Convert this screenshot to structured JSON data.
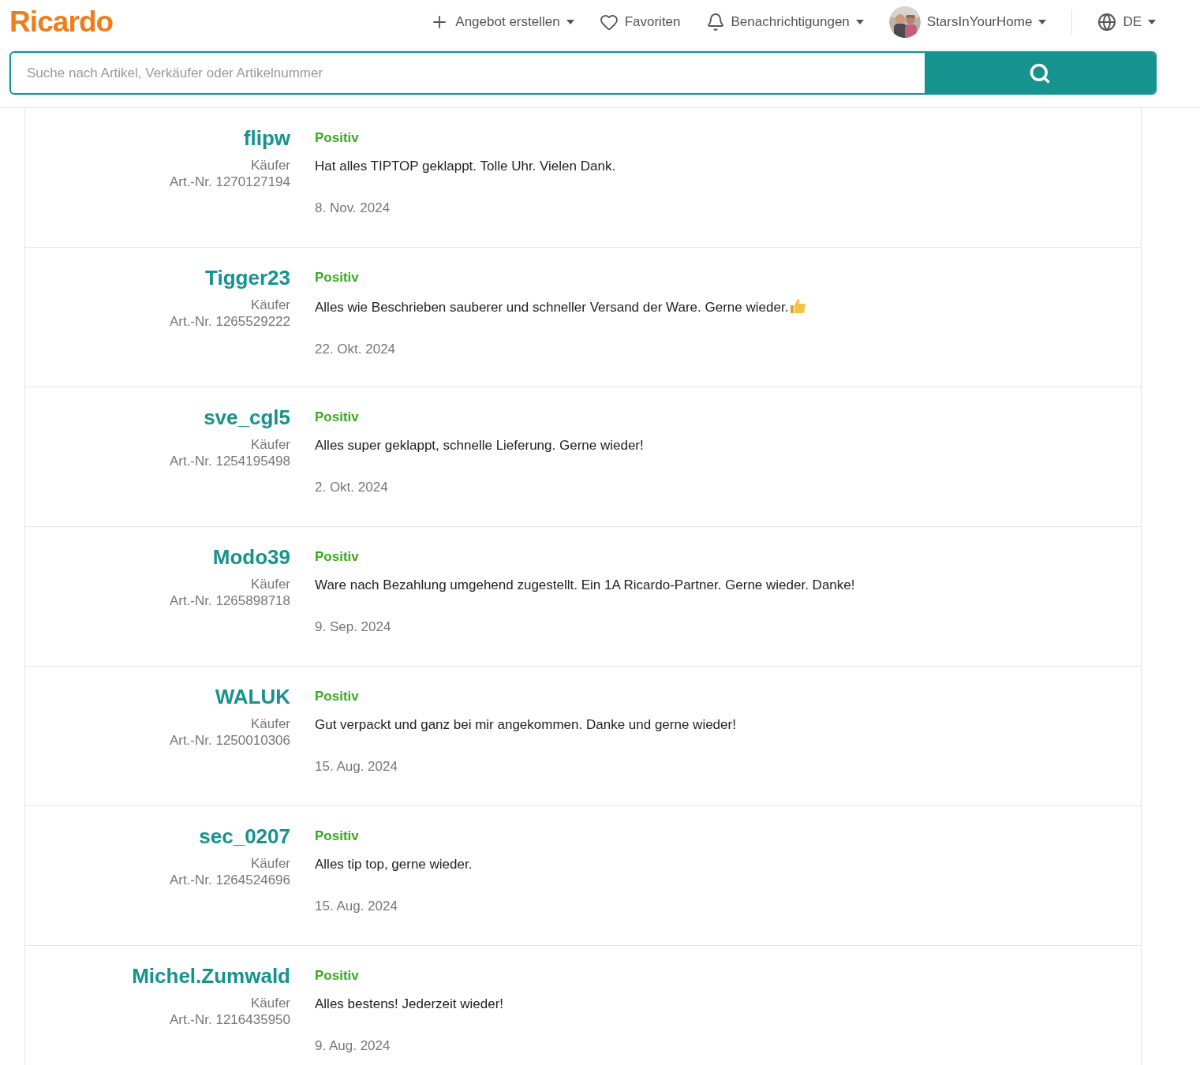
{
  "header": {
    "logo": "Ricardo",
    "nav": [
      {
        "kind": "create",
        "label": "Angebot erstellen",
        "dropdown": true
      },
      {
        "kind": "favorites",
        "label": "Favoriten",
        "dropdown": false
      },
      {
        "kind": "notifications",
        "label": "Benachrichtigungen",
        "dropdown": true
      },
      {
        "kind": "user",
        "label": "StarsInYourHome",
        "dropdown": true
      },
      {
        "kind": "language",
        "label": "DE",
        "dropdown": true
      }
    ],
    "search": {
      "placeholder": "Suche nach Artikel, Verkäufer oder Artikelnummer"
    }
  },
  "reviews": [
    {
      "user": "flipw",
      "role": "Käufer",
      "article": "Art.-Nr. 1270127194",
      "rating": "Positiv",
      "kind": "positive",
      "comment": "Hat alles TIPTOP geklappt. Tolle Uhr. Vielen Dank.",
      "thumbs_up": false,
      "date": "8. Nov. 2024"
    },
    {
      "user": "Tigger23",
      "role": "Käufer",
      "article": "Art.-Nr. 1265529222",
      "rating": "Positiv",
      "kind": "positive",
      "comment": "Alles wie Beschrieben sauberer und schneller Versand der Ware. Gerne wieder.",
      "thumbs_up": true,
      "date": "22. Okt. 2024"
    },
    {
      "user": "sve_cgl5",
      "role": "Käufer",
      "article": "Art.-Nr. 1254195498",
      "rating": "Positiv",
      "kind": "positive",
      "comment": "Alles super geklappt, schnelle Lieferung. Gerne wieder!",
      "thumbs_up": false,
      "date": "2. Okt. 2024"
    },
    {
      "user": "Modo39",
      "role": "Käufer",
      "article": "Art.-Nr. 1265898718",
      "rating": "Positiv",
      "kind": "positive",
      "comment": "Ware nach Bezahlung umgehend zugestellt. Ein 1A Ricardo-Partner. Gerne wieder. Danke!",
      "thumbs_up": false,
      "date": "9. Sep. 2024"
    },
    {
      "user": "WALUK",
      "role": "Käufer",
      "article": "Art.-Nr. 1250010306",
      "rating": "Positiv",
      "kind": "positive",
      "comment": "Gut verpackt und ganz bei mir angekommen. Danke und gerne wieder!",
      "thumbs_up": false,
      "date": "15. Aug. 2024"
    },
    {
      "user": "sec_0207",
      "role": "Käufer",
      "article": "Art.-Nr. 1264524696",
      "rating": "Positiv",
      "kind": "positive",
      "comment": "Alles tip top, gerne wieder.",
      "thumbs_up": false,
      "date": "15. Aug. 2024"
    },
    {
      "user": "Michel.Zumwald",
      "role": "Käufer",
      "article": "Art.-Nr. 1216435950",
      "rating": "Positiv",
      "kind": "positive",
      "comment": "Alles bestens! Jederzeit wieder!",
      "thumbs_up": false,
      "date": "9. Aug. 2024"
    }
  ]
}
